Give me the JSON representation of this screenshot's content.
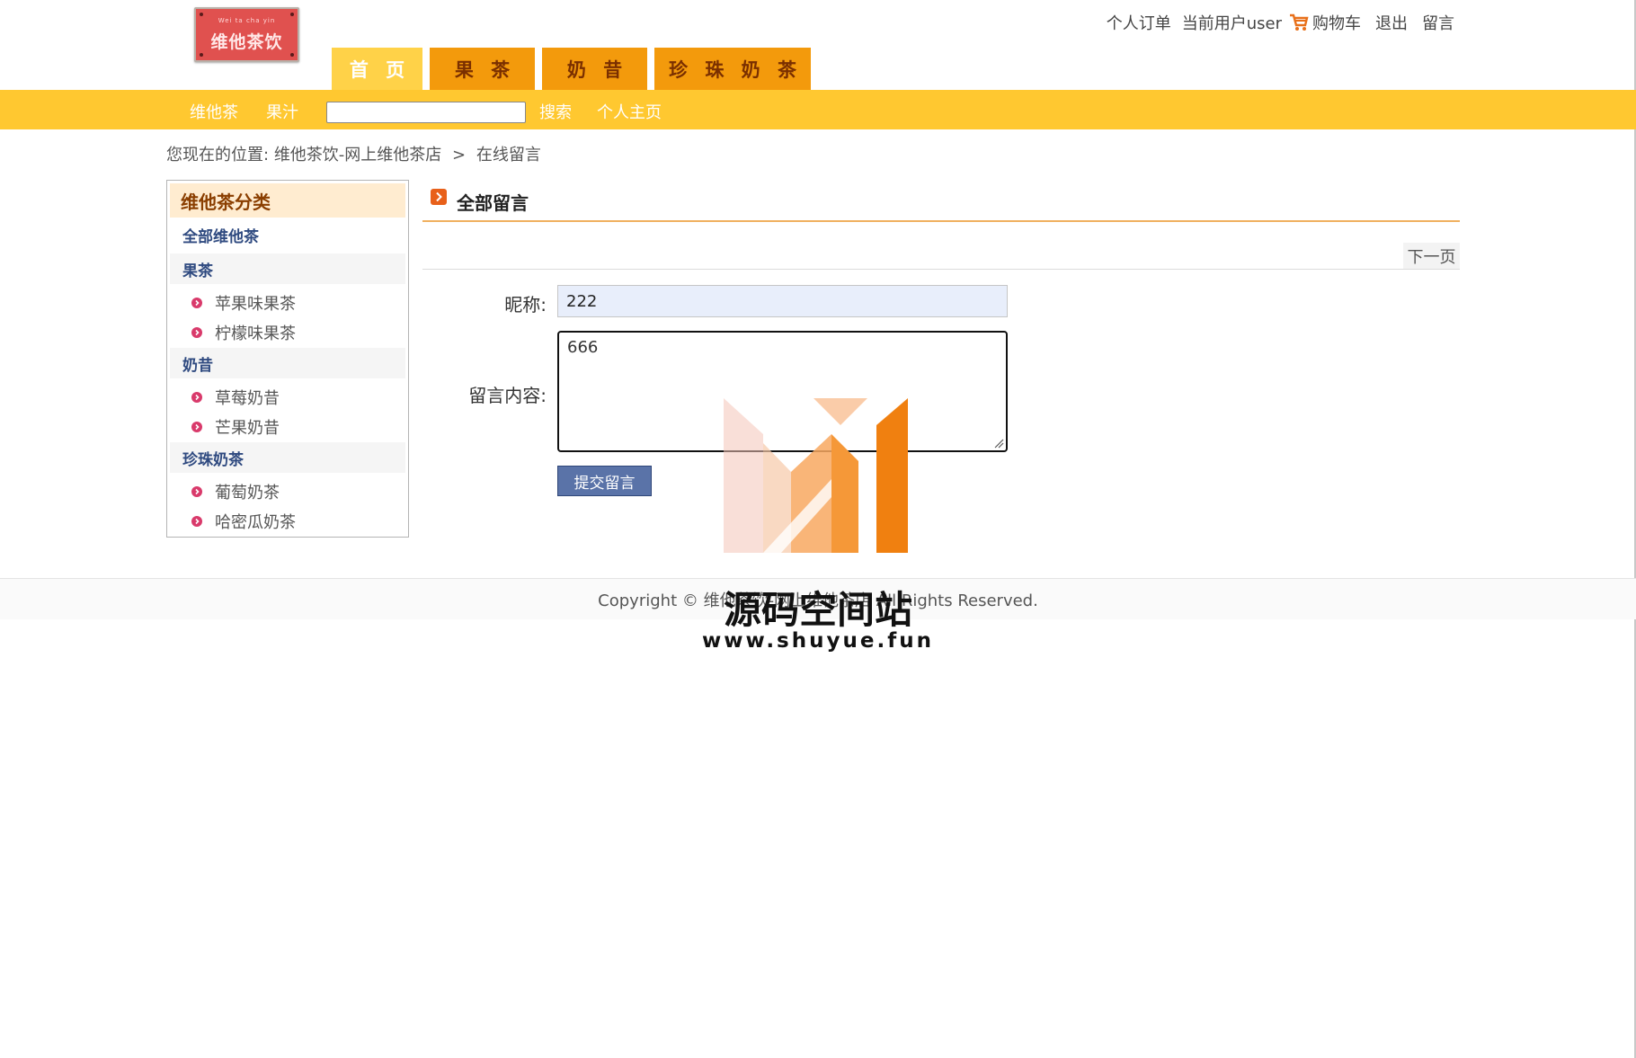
{
  "header": {
    "logo_text": "维他茶饮",
    "logo_small_text": "Wei ta cha yin",
    "links": {
      "orders": "个人订单",
      "current_user": "当前用户user",
      "cart": "购物车",
      "logout": "退出",
      "message": "留言"
    },
    "tabs": [
      {
        "label": "首 页"
      },
      {
        "label": "果 茶"
      },
      {
        "label": "奶 昔"
      },
      {
        "label": "珍 珠 奶 茶"
      }
    ],
    "subnav": {
      "link1": "维他茶",
      "link2": "果汁",
      "search_value": "",
      "search_label": "搜索",
      "profile": "个人主页"
    }
  },
  "breadcrumb": {
    "prefix": "您现在的位置:",
    "home": "维他茶饮-网上维他茶店",
    "separator": ">",
    "current": "在线留言"
  },
  "sidebar": {
    "title": "维他茶分类",
    "all": "全部维他茶",
    "categories": [
      {
        "name": "果茶",
        "items": [
          "苹果味果茶",
          "柠檬味果茶"
        ]
      },
      {
        "name": "奶昔",
        "items": [
          "草莓奶昔",
          "芒果奶昔"
        ]
      },
      {
        "name": "珍珠奶茶",
        "items": [
          "葡萄奶茶",
          "哈密瓜奶茶"
        ]
      }
    ]
  },
  "main": {
    "title": "全部留言",
    "next_page": "下一页",
    "form": {
      "nickname_label": "昵称:",
      "nickname_value": "222",
      "content_label": "留言内容:",
      "content_value": "666",
      "submit_label": "提交留言"
    }
  },
  "footer": {
    "copyright": "Copyright © 维他茶饮-网上维他茶店 All Rights Reserved."
  },
  "watermark": {
    "title": "源码空间站",
    "url": "www.shuyue.fun"
  },
  "colors": {
    "accent_orange": "#f39a0c",
    "active_tab": "#ffd248",
    "nav_bar": "#ffc830",
    "submit_button": "#5a73a8",
    "sidebar_category": "#2f4a80"
  }
}
